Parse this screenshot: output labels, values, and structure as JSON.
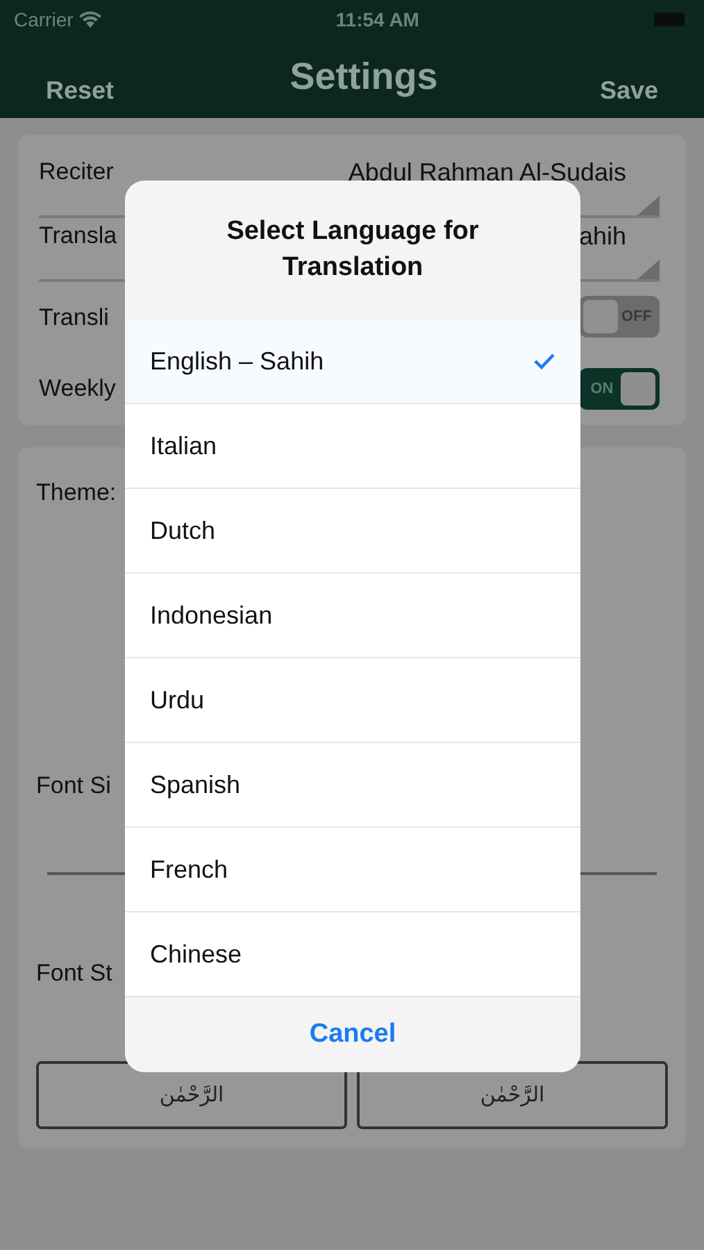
{
  "status_bar": {
    "carrier": "Carrier",
    "time": "11:54 AM"
  },
  "nav": {
    "left": "Reset",
    "title": "Settings",
    "right": "Save"
  },
  "settings": [
    {
      "kind": "dropdown",
      "label": "Reciter",
      "value": "Abdul Rahman Al-Sudais"
    },
    {
      "kind": "dropdown",
      "label": "Transla",
      "value": "ahih"
    },
    {
      "kind": "toggle",
      "label": "Transli",
      "on": false,
      "state_text": "OFF"
    },
    {
      "kind": "toggle",
      "label": "Weekly",
      "on": true,
      "state_text": "ON"
    }
  ],
  "appearance": {
    "theme_label": "Theme:",
    "font_size_label": "Font Si",
    "font_style_label": "Font St",
    "font_styles": [
      "الرَّحْمٰن",
      "الرَّحْمٰن"
    ]
  },
  "dialog": {
    "title": "Select Language for Translation",
    "options": [
      {
        "label": "English – Sahih",
        "selected": true
      },
      {
        "label": "Italian",
        "selected": false
      },
      {
        "label": "Dutch",
        "selected": false
      },
      {
        "label": "Indonesian",
        "selected": false
      },
      {
        "label": "Urdu",
        "selected": false
      },
      {
        "label": "Spanish",
        "selected": false
      },
      {
        "label": "French",
        "selected": false
      },
      {
        "label": "Chinese",
        "selected": false
      }
    ],
    "cancel": "Cancel"
  }
}
